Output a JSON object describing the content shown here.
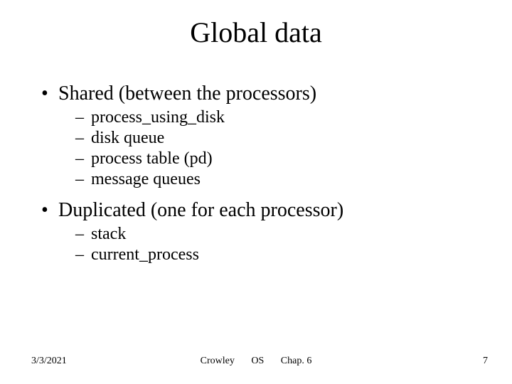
{
  "title": "Global data",
  "bullets": [
    {
      "text": "Shared (between the processors)",
      "sub": [
        "process_using_disk",
        "disk queue",
        "process table (pd)",
        "message queues"
      ]
    },
    {
      "text": "Duplicated (one for each processor)",
      "sub": [
        "stack",
        "current_process"
      ]
    }
  ],
  "footer": {
    "date": "3/3/2021",
    "author": "Crowley",
    "course": "OS",
    "chapter": "Chap. 6",
    "page": "7"
  },
  "glyphs": {
    "bullet1": "•",
    "bullet2": "–"
  }
}
